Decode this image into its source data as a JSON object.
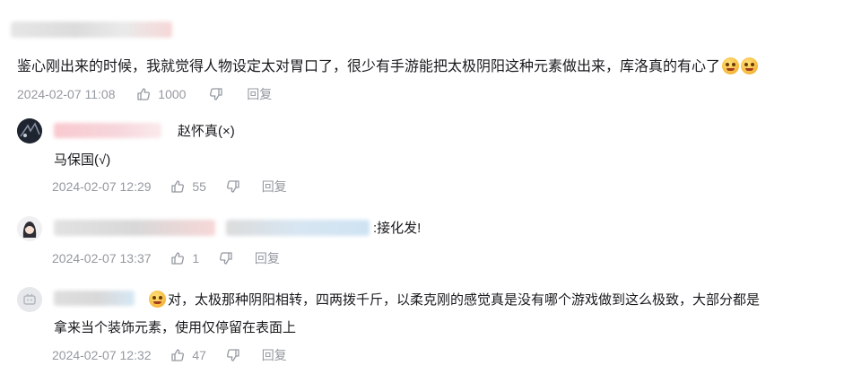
{
  "top_comment": {
    "text": "鉴心刚出来的时候，我就觉得人物设定太对胃口了，很少有手游能把太极阴阳这种元素做出来，库洛真的有心了",
    "emoji_names": [
      "thinking-emoji",
      "thinking-emoji"
    ],
    "time": "2024-02-07 11:08",
    "likes": "1000",
    "reply_label": "回复"
  },
  "replies": [
    {
      "name_suffix": "赵怀真(×)",
      "text": "马保国(√)",
      "time": "2024-02-07 12:29",
      "likes": "55",
      "reply_label": "回复"
    },
    {
      "name_suffix": ":接化发!",
      "time": "2024-02-07 13:37",
      "likes": "1",
      "reply_label": "回复"
    },
    {
      "text_line1": "对，太极那种阴阳相转，四两拨千斤，以柔克刚的感觉真是没有哪个游戏做到这么极致，大部分都是",
      "text_line2": "拿来当个装饰元素，使用仅停留在表面上",
      "time": "2024-02-07 12:32",
      "likes": "47",
      "reply_label": "回复"
    }
  ],
  "colors": {
    "meta": "#9499a0",
    "text": "#18191c",
    "divider": "#e3e5e7"
  }
}
